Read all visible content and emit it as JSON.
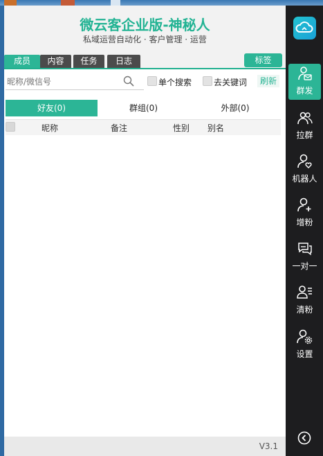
{
  "app": {
    "title": "微云客企业版-神秘人",
    "subtitle": "私域运营自动化 · 客户管理 · 运营",
    "version": "V3.1"
  },
  "tabs": [
    {
      "label": "成员",
      "active": true
    },
    {
      "label": "内容",
      "active": false
    },
    {
      "label": "任务",
      "active": false
    },
    {
      "label": "日志",
      "active": false
    }
  ],
  "tag_button": "标签",
  "search": {
    "placeholder": "昵称/微信号"
  },
  "options": {
    "single_search": "单个搜索",
    "remove_keyword": "去关键词",
    "refresh": "刷新"
  },
  "subtabs": [
    {
      "label": "好友(0)",
      "active": true
    },
    {
      "label": "群组(0)",
      "active": false
    },
    {
      "label": "外部(0)",
      "active": false
    }
  ],
  "table": {
    "columns": [
      "昵称",
      "备注",
      "性别",
      "别名"
    ]
  },
  "sidebar": {
    "items": [
      {
        "label": "群发",
        "icon": "user-message-icon",
        "active": true
      },
      {
        "label": "拉群",
        "icon": "users-icon",
        "active": false
      },
      {
        "label": "机器人",
        "icon": "user-heart-icon",
        "active": false
      },
      {
        "label": "增粉",
        "icon": "user-plus-icon",
        "active": false
      },
      {
        "label": "一对一",
        "icon": "chat-bubbles-icon",
        "active": false
      },
      {
        "label": "清粉",
        "icon": "user-list-icon",
        "active": false
      },
      {
        "label": "设置",
        "icon": "user-gear-icon",
        "active": false
      }
    ]
  },
  "colors": {
    "accent": "#2cb596",
    "sidebar_bg": "#1d1d1f",
    "title": "#22b393"
  }
}
